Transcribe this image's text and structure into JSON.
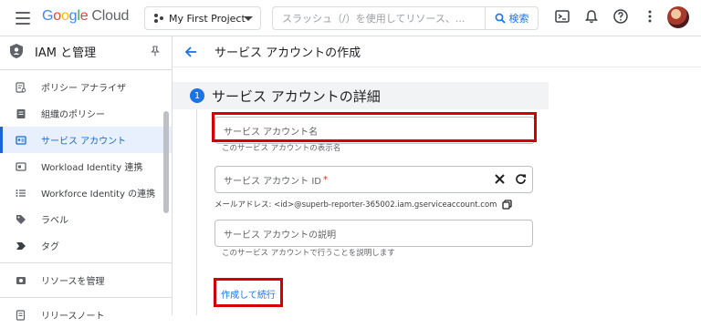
{
  "topbar": {
    "logo_google": "Google",
    "logo_cloud": "Cloud",
    "project_name": "My First Project",
    "search_placeholder": "スラッシュ（/）を使用してリソース、...",
    "search_button": "検索"
  },
  "sidebar": {
    "title": "IAM と管理",
    "items": [
      {
        "label": "ポリシー アナライザ",
        "icon": "policy-analyzer-icon"
      },
      {
        "label": "組織のポリシー",
        "icon": "org-policy-icon"
      },
      {
        "label": "サービス アカウント",
        "icon": "service-account-icon",
        "active": true
      },
      {
        "label": "Workload Identity 連携",
        "icon": "workload-identity-icon"
      },
      {
        "label": "Workforce Identity の連携",
        "icon": "workforce-identity-icon"
      },
      {
        "label": "ラベル",
        "icon": "label-icon"
      },
      {
        "label": "タグ",
        "icon": "tag-icon"
      },
      {
        "label": "リソースを管理",
        "icon": "manage-resources-icon"
      },
      {
        "label": "リリースノート",
        "icon": "release-notes-icon"
      }
    ]
  },
  "main": {
    "page_title": "サービス アカウントの作成",
    "step_number": "1",
    "step_title": "サービス アカウントの詳細",
    "name_field_label": "サービス アカウント名",
    "name_field_hint": "このサービス アカウントの表示名",
    "id_field_label": "サービス アカウント ID",
    "id_required": "*",
    "email_label": "メールアドレス: <id>@superb-reporter-365002.iam.gserviceaccount.com",
    "desc_field_label": "サービス アカウントの説明",
    "desc_field_hint": "このサービス アカウントで行うことを説明します",
    "create_button": "作成して続行"
  },
  "colors": {
    "accent": "#1a73e8",
    "highlight_box": "#d40000",
    "active_bg": "#e8f0fe"
  }
}
